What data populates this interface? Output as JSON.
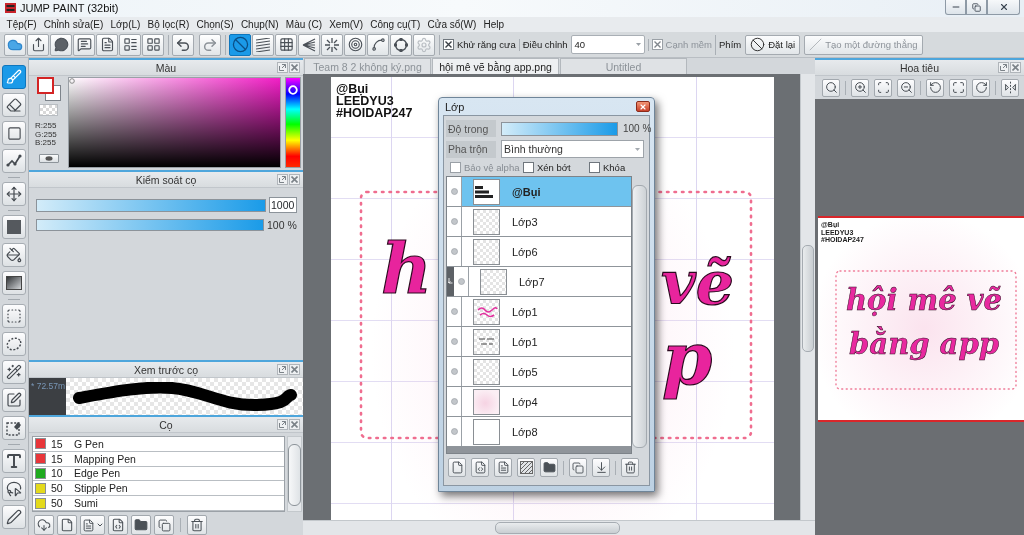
{
  "window": {
    "title": "JUMP PAINT (32bit)"
  },
  "menu": [
    "Tệp(F)",
    "Chỉnh sửa(E)",
    "Lớp(L)",
    "Bộ lọc(R)",
    "Chọn(S)",
    "Chụp(N)",
    "Màu (C)",
    "Xem(V)",
    "Công cụ(T)",
    "Cửa sổ(W)",
    "Help"
  ],
  "toolbar": {
    "ruler_buttons": [
      {
        "selected": true,
        "disabled": false
      },
      {
        "selected": false,
        "disabled": false
      },
      {
        "selected": false,
        "disabled": false
      },
      {
        "selected": false,
        "disabled": false
      },
      {
        "selected": false,
        "disabled": false
      },
      {
        "selected": false,
        "disabled": false
      },
      {
        "selected": false,
        "disabled": false
      },
      {
        "selected": false,
        "disabled": false
      },
      {
        "selected": false,
        "disabled": true
      }
    ],
    "antialias": {
      "label": "Khử răng cưa",
      "checked": true
    },
    "adjust": {
      "label": "Điều chỉnh",
      "value": "40"
    },
    "soft_edge": {
      "label": "Cạnh mềm",
      "checked": true,
      "disabled": true
    },
    "keys_label": "Phím",
    "buttons": [
      {
        "label": "Đặt lại",
        "disabled": false
      },
      {
        "label": "Tạo một đường thẳng",
        "disabled": true
      }
    ]
  },
  "tools": [
    {
      "selected": true
    },
    {
      "selected": false
    },
    {
      "selected": false
    },
    {
      "selected": false
    },
    {
      "selected": false
    },
    {
      "selected": false
    },
    {
      "selected": false
    },
    {
      "selected": false
    },
    {
      "selected": false
    },
    {
      "selected": false
    },
    {
      "selected": false
    },
    {
      "selected": false
    },
    {
      "selected": false
    },
    {
      "selected": false
    },
    {
      "selected": false
    },
    {
      "selected": false
    }
  ],
  "color_panel": {
    "title": "Màu",
    "readout": [
      "R:255",
      "G:255",
      "B:255"
    ],
    "hue": {
      "level": 0.86
    }
  },
  "brush_control": {
    "title": "Kiểm soát cọ",
    "size": {
      "level": 1,
      "value": "1000"
    },
    "opacity": {
      "level": 1,
      "reading": "100 %"
    }
  },
  "brush_preview": {
    "title": "Xem trước cọ",
    "size_text": "* 72.57m"
  },
  "brushes": {
    "title": "Cọ",
    "items": [
      {
        "color": "#e8363a",
        "size": "15",
        "name": "G Pen"
      },
      {
        "color": "#e8363a",
        "size": "15",
        "name": "Mapping Pen"
      },
      {
        "color": "#1faa1f",
        "size": "10",
        "name": "Edge Pen"
      },
      {
        "color": "#e4da1c",
        "size": "50",
        "name": "Stipple Pen"
      },
      {
        "color": "#e4da1c",
        "size": "50",
        "name": "Sumi"
      }
    ]
  },
  "document_tabs": [
    {
      "label": "Team 8 2 không ký.png",
      "selected": false
    },
    {
      "label": "hội mê vẽ bằng app.png",
      "selected": true
    },
    {
      "label": "Untitled",
      "selected": false
    }
  ],
  "canvas": {
    "caption_lines": [
      "@Bụi",
      "LEEDYU3",
      "#HOIDAP247"
    ],
    "lettering_fragments": [
      "h",
      "vẽ",
      "p"
    ]
  },
  "layer_panel": {
    "title": "Lớp",
    "opacity": {
      "label": "Độ trong",
      "level": 1,
      "reading": "100 %"
    },
    "blend": {
      "label": "Pha trộn",
      "value": "Bình thường"
    },
    "options": [
      {
        "label": "Bảo vệ alpha",
        "checked": false,
        "disabled": true
      },
      {
        "label": "Xén bớt",
        "checked": false,
        "disabled": false
      },
      {
        "label": "Khóa",
        "checked": false,
        "disabled": false
      }
    ],
    "layers": [
      {
        "name": "@Bụi",
        "selected": true,
        "clipped": false,
        "kind": "text"
      },
      {
        "name": "Lớp3",
        "selected": false,
        "clipped": false,
        "kind": "empty"
      },
      {
        "name": "Lớp6",
        "selected": false,
        "clipped": false,
        "kind": "empty"
      },
      {
        "name": "Lớp7",
        "selected": false,
        "clipped": true,
        "kind": "empty"
      },
      {
        "name": "Lớp1",
        "selected": false,
        "clipped": false,
        "kind": "lettering"
      },
      {
        "name": "Lớp1",
        "selected": false,
        "clipped": false,
        "kind": "sketch"
      },
      {
        "name": "Lớp5",
        "selected": false,
        "clipped": false,
        "kind": "empty"
      },
      {
        "name": "Lớp4",
        "selected": false,
        "clipped": false,
        "kind": "wash"
      },
      {
        "name": "Lớp8",
        "selected": false,
        "clipped": false,
        "kind": "white"
      }
    ]
  },
  "navigator": {
    "title": "Hoa tiêu",
    "preview": {
      "caption_lines": [
        "@Bụi",
        "LEEDYU3",
        "#HOIDAP247"
      ],
      "lettering_lines": [
        "hội mê vẽ",
        "bằng app"
      ]
    }
  }
}
